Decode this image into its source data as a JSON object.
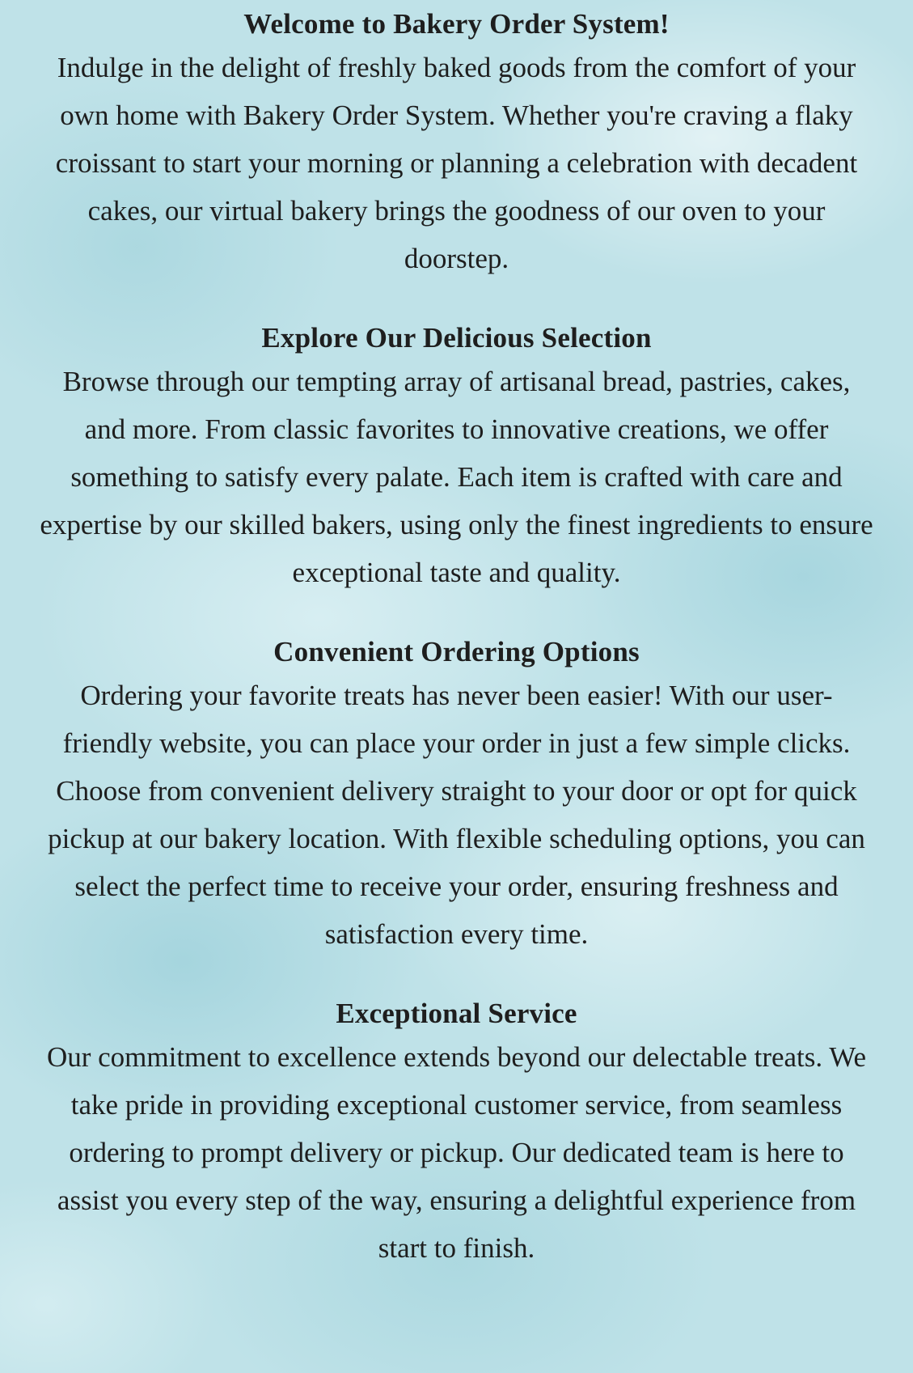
{
  "sections": [
    {
      "heading": "Welcome to Bakery Order System!",
      "lines": [
        "Indulge in the delight of freshly baked goods from the comfort of your",
        "own home with Bakery Order System. Whether you're craving a flaky",
        "croissant to start your morning or planning a celebration with decadent",
        "cakes, our virtual bakery brings the goodness of our oven to your",
        "doorstep."
      ]
    },
    {
      "heading": "Explore Our Delicious Selection",
      "lines": [
        "Browse through our tempting array of artisanal bread, pastries, cakes,",
        "and more. From classic favorites to innovative creations, we offer",
        "something to satisfy every palate. Each item is crafted with care and",
        "expertise by our skilled bakers, using only the finest ingredients to ensure",
        "exceptional taste and quality."
      ]
    },
    {
      "heading": "Convenient Ordering Options",
      "lines": [
        "Ordering your favorite treats has never been easier! With our user-",
        "friendly website, you can place your order in just a few simple clicks.",
        "Choose from convenient delivery straight to your door or opt for quick",
        "pickup at our bakery location. With flexible scheduling options, you can",
        "select the perfect time to receive your order, ensuring freshness and",
        "satisfaction every time."
      ]
    },
    {
      "heading": "Exceptional Service",
      "lines": [
        "Our commitment to excellence extends beyond our delectable treats. We",
        "take pride in providing exceptional customer service, from seamless",
        "ordering to prompt delivery or pickup. Our dedicated team is here to",
        "assist you every step of the way, ensuring a delightful experience from",
        "start to finish."
      ]
    }
  ]
}
